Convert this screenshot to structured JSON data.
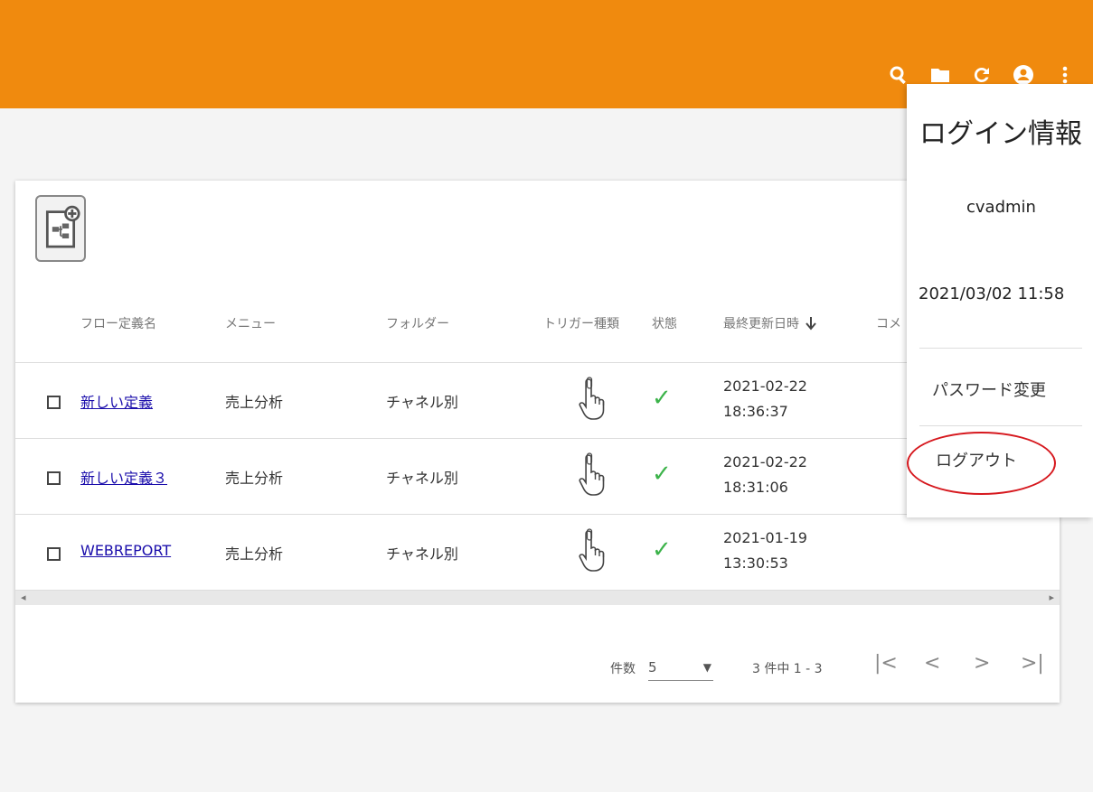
{
  "header": {
    "icons": [
      "search-icon",
      "folder-icon",
      "refresh-icon",
      "account-icon",
      "more-vert-icon"
    ],
    "accent_color": "#f08a0e"
  },
  "table": {
    "columns": [
      "フロー定義名",
      "メニュー",
      "フォルダー",
      "トリガー種類",
      "状態",
      "最終更新日時",
      "コメ"
    ],
    "sort_icon": "arrow-down-icon",
    "rows": [
      {
        "name": "新しい定義",
        "menu": "売上分析",
        "folder": "チャネル別",
        "trigger": "touch-icon",
        "status": "✓",
        "date": "2021-02-22",
        "time": "18:36:37"
      },
      {
        "name": "新しい定義３",
        "menu": "売上分析",
        "folder": "チャネル別",
        "trigger": "touch-icon",
        "status": "✓",
        "date": "2021-02-22",
        "time": "18:31:06"
      },
      {
        "name": "WEBREPORT",
        "menu": "売上分析",
        "folder": "チャネル別",
        "trigger": "touch-icon",
        "status": "✓",
        "date": "2021-01-19",
        "time": "13:30:53"
      }
    ]
  },
  "pager": {
    "count_label": "件数",
    "page_size": "5",
    "range": "3 件中 1 - 3",
    "first": "|<",
    "prev": "<",
    "next": ">",
    "last": ">|"
  },
  "login_menu": {
    "title": "ログイン情報",
    "user": "cvadmin",
    "timestamp": "2021/03/02 11:58",
    "change_password": "パスワード変更",
    "logout": "ログアウト",
    "highlight_color": "#d6181e"
  }
}
